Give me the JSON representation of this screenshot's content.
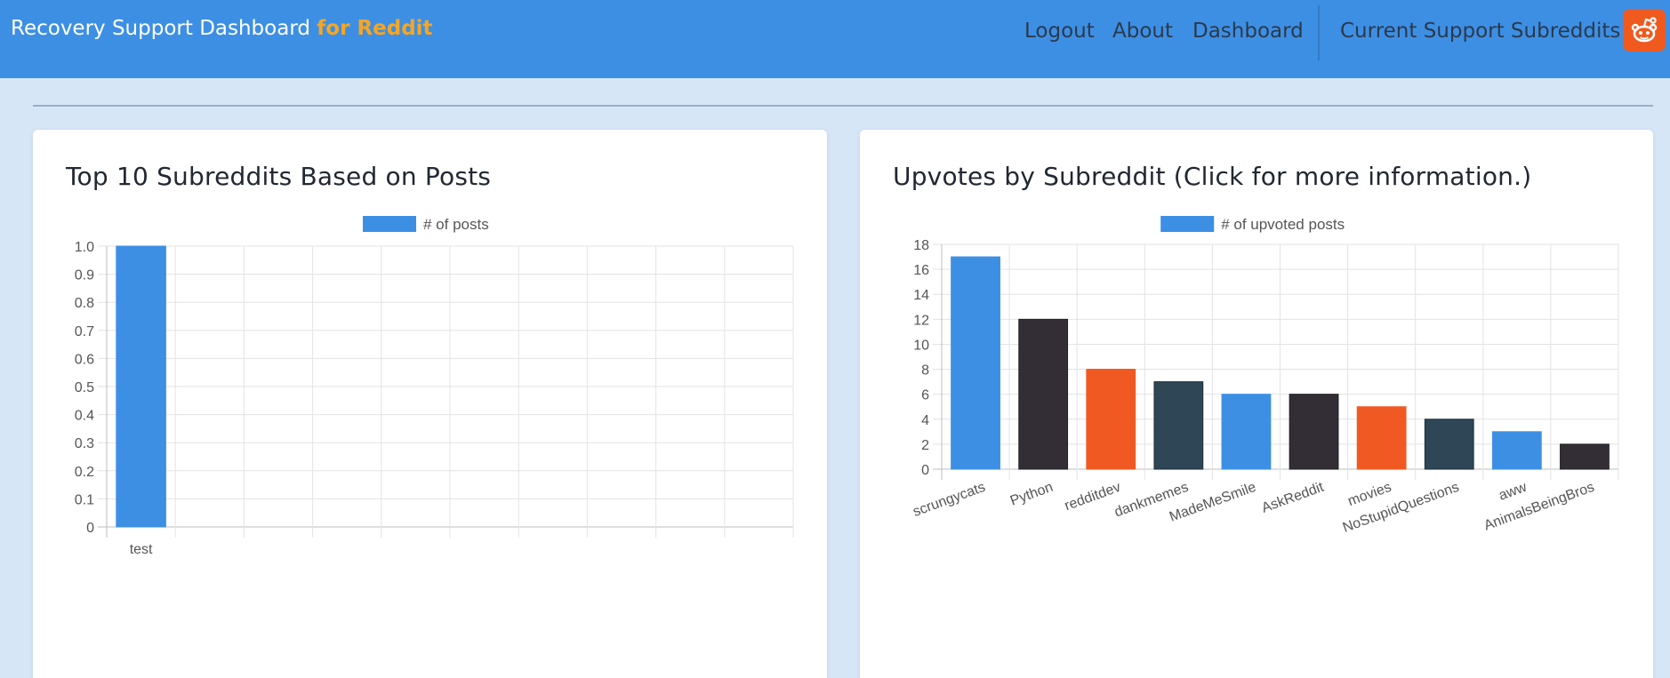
{
  "navbar": {
    "brand_main": "Recovery Support Dashboard ",
    "brand_accent": "for Reddit",
    "links": [
      "Logout",
      "About",
      "Dashboard",
      "Current Support Subreddits"
    ],
    "reddit_icon": "reddit-alien-icon",
    "background": "#3d8fe4",
    "accent": "#f6a623"
  },
  "cards": [
    {
      "title": "Top 10 Subreddits Based on Posts"
    },
    {
      "title": "Upvotes by Subreddit (Click for more information.)"
    }
  ],
  "chart_data": [
    {
      "type": "bar",
      "title": "Top 10 Subreddits Based on Posts",
      "legend": "# of posts",
      "legend_position": "top",
      "categories": [
        "test"
      ],
      "values": [
        1
      ],
      "slots": 10,
      "ylim": [
        0,
        1.0
      ],
      "yticks": [
        "0",
        "0.1",
        "0.2",
        "0.3",
        "0.4",
        "0.5",
        "0.6",
        "0.7",
        "0.8",
        "0.9",
        "1.0"
      ],
      "grid": true,
      "colors": [
        "#3d8fe4"
      ]
    },
    {
      "type": "bar",
      "title": "Upvotes by Subreddit (Click for more information.)",
      "legend": "# of upvoted posts",
      "legend_position": "top",
      "categories": [
        "scrungycats",
        "Python",
        "redditdev",
        "dankmemes",
        "MadeMeSmile",
        "AskReddit",
        "movies",
        "NoStupidQuestions",
        "aww",
        "AnimalsBeingBros"
      ],
      "values": [
        17,
        12,
        8,
        7,
        6,
        6,
        5,
        4,
        3,
        2
      ],
      "ylim": [
        0,
        18
      ],
      "yticks": [
        "0",
        "2",
        "4",
        "6",
        "8",
        "10",
        "12",
        "14",
        "16",
        "18"
      ],
      "grid": true,
      "colors": [
        "#3d8fe4",
        "#332e36",
        "#f05a22",
        "#2e4656",
        "#3d8fe4",
        "#332e36",
        "#f05a22",
        "#2e4656",
        "#3d8fe4",
        "#332e36"
      ]
    }
  ]
}
